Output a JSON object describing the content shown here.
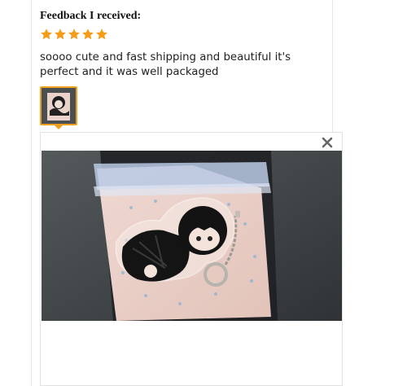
{
  "feedback": {
    "heading": "Feedback I received:",
    "rating": 5,
    "rating_max": 5,
    "review_text": "soooo cute and fast shipping and beautiful it's perfect and it was well packaged",
    "star_color": "#f59d1b",
    "thumbnail_border_color": "#f0a01e"
  },
  "viewer": {
    "close_icon": "close-icon",
    "photo_icon": "product-photo"
  }
}
